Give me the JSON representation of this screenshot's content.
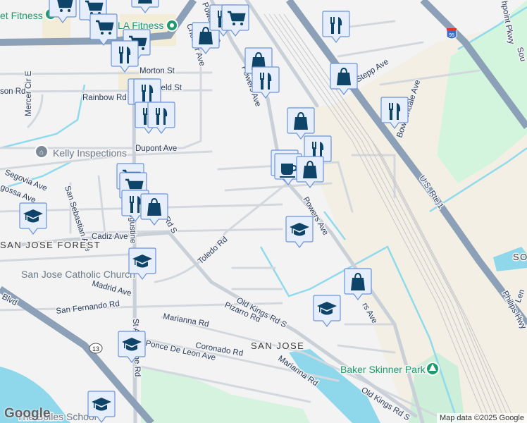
{
  "map": {
    "roads": [
      "Morton St",
      "ield St",
      "Rainbow Rd",
      "son Rd",
      "Mercer Cir E",
      "Chester Ave",
      "Powers Ave",
      "Powers Ave",
      "Powers Ave",
      "Dupont Ave",
      "Segovia Ave",
      "gossa Ave",
      "San Sebastian Ave",
      "Cadiz Ave",
      "ugustine",
      "s Rd S",
      "Toledo Rd",
      "Madrid Ave",
      "San Fernando Rd",
      "Blvd",
      "Marianna Rd",
      "Pizarro Rd",
      "Old Kings Rd S",
      "Old Kings Rd S",
      "Coronado Rd",
      "Ponce De Leon Ave",
      "Marianna Rd",
      "St Augustine Rd",
      "Stepp Ave",
      "Bowdendale Ave",
      "U.S. Rte 1",
      "Philips Hwy",
      "hpoint Pkwy",
      "Sou",
      "Len",
      "rs Ave"
    ],
    "route_shields": [
      "13",
      "95"
    ],
    "neighborhoods": [
      "SAN JOSE FOREST",
      "SAN JOSE",
      "SO"
    ],
    "places": {
      "fitness_left": "et Fitness",
      "fitness_la": "LA Fitness",
      "kelly": "Kelly Inspections",
      "church": "San Jose Catholic Church",
      "park": "Baker Skinner Park",
      "school": "The Bolles School"
    },
    "marker_types": [
      "shopping-cart",
      "restaurant",
      "shopping-bag",
      "coffee",
      "school"
    ]
  },
  "attribution": {
    "logo": "Google",
    "text": "Map data ©2025 Google"
  }
}
